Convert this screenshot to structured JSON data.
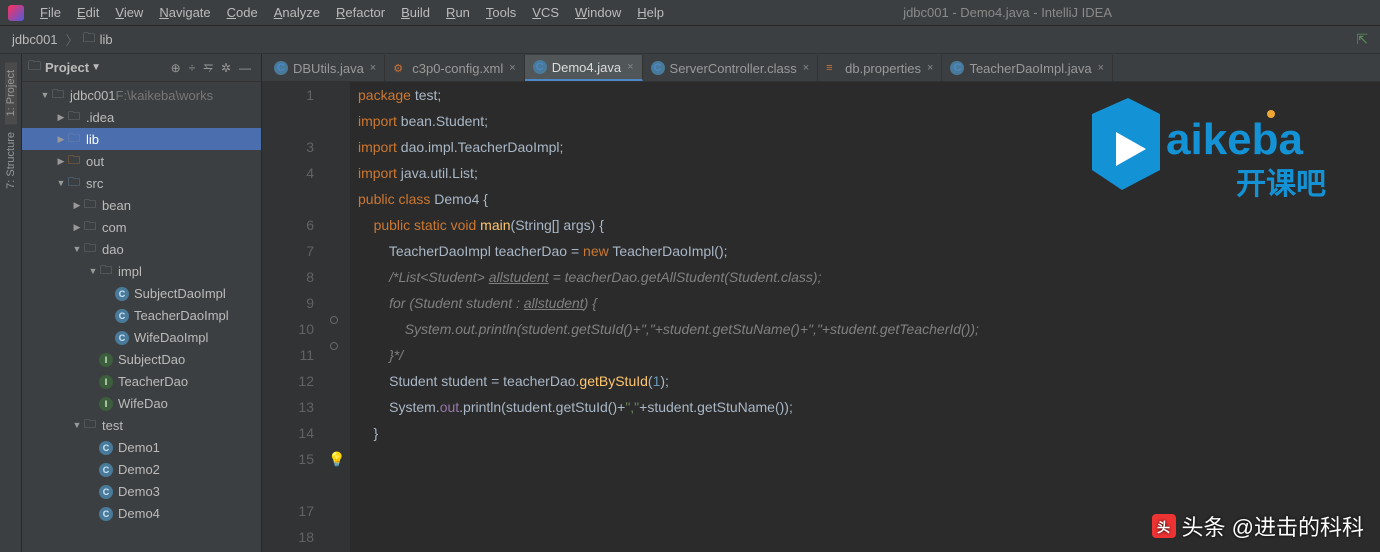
{
  "window": {
    "title": "jdbc001 - Demo4.java - IntelliJ IDEA"
  },
  "menu": [
    "File",
    "Edit",
    "View",
    "Navigate",
    "Code",
    "Analyze",
    "Refactor",
    "Build",
    "Run",
    "Tools",
    "VCS",
    "Window",
    "Help"
  ],
  "breadcrumb": {
    "root": "jdbc001",
    "folder": "lib"
  },
  "project_panel": {
    "title": "Project"
  },
  "tree": [
    {
      "depth": 1,
      "arrow": "▼",
      "icon": "folder-dark",
      "label": "jdbc001",
      "hint": "F:\\kaikeba\\works"
    },
    {
      "depth": 2,
      "arrow": "▶",
      "icon": "folder-dark",
      "label": ".idea"
    },
    {
      "depth": 2,
      "arrow": "▶",
      "icon": "folder-dark",
      "label": "lib",
      "selected": true
    },
    {
      "depth": 2,
      "arrow": "▶",
      "icon": "folder-orange",
      "label": "out"
    },
    {
      "depth": 2,
      "arrow": "▼",
      "icon": "folder-blue",
      "label": "src"
    },
    {
      "depth": 3,
      "arrow": "▶",
      "icon": "folder-dark",
      "label": "bean"
    },
    {
      "depth": 3,
      "arrow": "▶",
      "icon": "folder-dark",
      "label": "com"
    },
    {
      "depth": 3,
      "arrow": "▼",
      "icon": "folder-dark",
      "label": "dao"
    },
    {
      "depth": 4,
      "arrow": "▼",
      "icon": "folder-dark",
      "label": "impl"
    },
    {
      "depth": 5,
      "arrow": "",
      "icon": "class",
      "label": "SubjectDaoImpl"
    },
    {
      "depth": 5,
      "arrow": "",
      "icon": "class",
      "label": "TeacherDaoImpl"
    },
    {
      "depth": 5,
      "arrow": "",
      "icon": "class",
      "label": "WifeDaoImpl"
    },
    {
      "depth": 4,
      "arrow": "",
      "icon": "interface",
      "label": "SubjectDao"
    },
    {
      "depth": 4,
      "arrow": "",
      "icon": "interface",
      "label": "TeacherDao"
    },
    {
      "depth": 4,
      "arrow": "",
      "icon": "interface",
      "label": "WifeDao"
    },
    {
      "depth": 3,
      "arrow": "▼",
      "icon": "folder-dark",
      "label": "test"
    },
    {
      "depth": 4,
      "arrow": "",
      "icon": "class",
      "label": "Demo1"
    },
    {
      "depth": 4,
      "arrow": "",
      "icon": "class",
      "label": "Demo2"
    },
    {
      "depth": 4,
      "arrow": "",
      "icon": "class",
      "label": "Demo3"
    },
    {
      "depth": 4,
      "arrow": "",
      "icon": "class",
      "label": "Demo4"
    }
  ],
  "tabs": [
    {
      "icon": "class",
      "label": "DBUtils.java"
    },
    {
      "icon": "xml",
      "label": "c3p0-config.xml"
    },
    {
      "icon": "class",
      "label": "Demo4.java",
      "active": true
    },
    {
      "icon": "class",
      "label": "ServerController.class"
    },
    {
      "icon": "prop",
      "label": "db.properties"
    },
    {
      "icon": "class",
      "label": "TeacherDaoImpl.java"
    }
  ],
  "gutter_lines": [
    "1",
    "",
    "3",
    "4",
    "",
    "6",
    "7",
    "8",
    "9",
    "10",
    "11",
    "12",
    "13",
    "14",
    "15",
    "",
    "17",
    "18"
  ],
  "code_lines": [
    {
      "html": "<span class='kw'>package</span> test;"
    },
    {
      "html": ""
    },
    {
      "html": "<span class='kw'>import</span> bean.Student;"
    },
    {
      "html": "<span class='kw'>import</span> dao.impl.TeacherDaoImpl;"
    },
    {
      "html": ""
    },
    {
      "html": "<span class='kw'>import</span> java.util.List;"
    },
    {
      "html": ""
    },
    {
      "html": "<span class='kw'>public class</span> Demo4 {",
      "run": true
    },
    {
      "html": "    <span class='kw'>public static void</span> <span class='fn'>main</span>(String[] args) {",
      "run": true
    },
    {
      "html": "        TeacherDaoImpl teacherDao = <span class='kw'>new</span> TeacherDaoImpl();"
    },
    {
      "html": "        <span class='cmt'>/*List&lt;Student&gt; <span class='ul-id'>allstudent</span> = teacherDao.getAllStudent(Student.class);</span>"
    },
    {
      "html": "        <span class='cmt'>for (Student student : <span class='ul-id'>allstudent</span>) {</span>"
    },
    {
      "html": "            <span class='cmt'>System.out.println(student.getStuId()+\",\"+student.getStuName()+\",\"+student.getTeacherId());</span>"
    },
    {
      "html": "        <span class='cmt'>}*/</span>"
    },
    {
      "html": "        Student student = teacherDao.<span class='fn'>getByStuId</span>(<span class='num'>1</span>);",
      "bulb": true
    },
    {
      "html": "        System.<span class='field'>out</span>.println(student.getStuId()+<span class='str'>\",\"</span>+student.getStuName());"
    },
    {
      "html": "    }"
    },
    {
      "html": ""
    }
  ],
  "watermark": {
    "logo_text_1": "aikeba",
    "logo_text_2": "开课吧",
    "bottom": "头条 @进击的科科"
  }
}
